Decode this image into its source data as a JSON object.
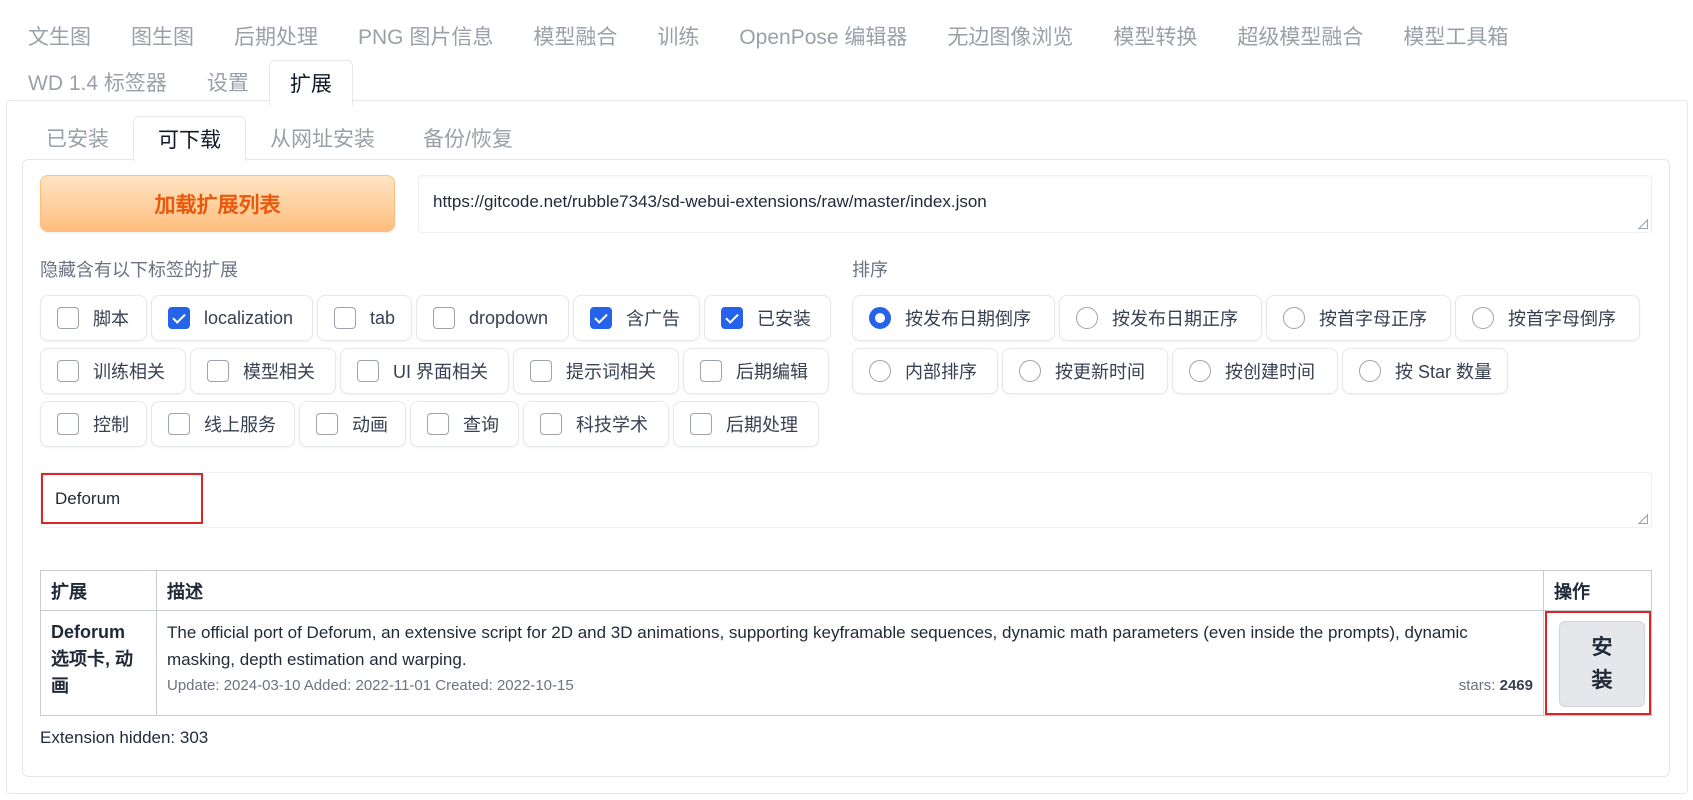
{
  "top_tabs": {
    "row1": [
      "文生图",
      "图生图",
      "后期处理",
      "PNG 图片信息",
      "模型融合",
      "训练",
      "OpenPose 编辑器",
      "无边图像浏览",
      "模型转换",
      "超级模型融合",
      "模型工具箱"
    ],
    "row2": [
      "WD 1.4 标签器",
      "设置",
      "扩展"
    ],
    "active": "扩展"
  },
  "sub_tabs": {
    "items": [
      "已安装",
      "可下载",
      "从网址安装",
      "备份/恢复"
    ],
    "active": "可下载"
  },
  "load_button_label": "加载扩展列表",
  "url_value": "https://gitcode.net/rubble7343/sd-webui-extensions/raw/master/index.json",
  "hide_tags": {
    "label": "隐藏含有以下标签的扩展",
    "rows": [
      [
        {
          "label": "脚本",
          "checked": false
        },
        {
          "label": "localization",
          "checked": true
        },
        {
          "label": "tab",
          "checked": false
        },
        {
          "label": "dropdown",
          "checked": false
        },
        {
          "label": "含广告",
          "checked": true
        },
        {
          "label": "已安装",
          "checked": true
        }
      ],
      [
        {
          "label": "训练相关",
          "checked": false
        },
        {
          "label": "模型相关",
          "checked": false
        },
        {
          "label": "UI 界面相关",
          "checked": false
        },
        {
          "label": "提示词相关",
          "checked": false
        },
        {
          "label": "后期编辑",
          "checked": false
        }
      ],
      [
        {
          "label": "控制",
          "checked": false
        },
        {
          "label": "线上服务",
          "checked": false
        },
        {
          "label": "动画",
          "checked": false
        },
        {
          "label": "查询",
          "checked": false
        },
        {
          "label": "科技学术",
          "checked": false
        },
        {
          "label": "后期处理",
          "checked": false
        }
      ]
    ]
  },
  "sort": {
    "label": "排序",
    "rows": [
      [
        {
          "label": "按发布日期倒序",
          "selected": true
        },
        {
          "label": "按发布日期正序",
          "selected": false
        },
        {
          "label": "按首字母正序",
          "selected": false
        },
        {
          "label": "按首字母倒序",
          "selected": false
        }
      ],
      [
        {
          "label": "内部排序",
          "selected": false
        },
        {
          "label": "按更新时间",
          "selected": false
        },
        {
          "label": "按创建时间",
          "selected": false
        },
        {
          "label": "按 Star 数量",
          "selected": false
        }
      ]
    ]
  },
  "search_value": "Deforum",
  "table": {
    "headers": [
      "扩展",
      "描述",
      "操作"
    ],
    "rows": [
      {
        "name_lines": [
          "Deforum",
          "选项卡, 动",
          "画"
        ],
        "description": "The official port of Deforum, an extensive script for 2D and 3D animations, supporting keyframable sequences, dynamic math parameters (even inside the prompts), dynamic masking, depth estimation and warping.",
        "meta": "Update: 2024-03-10 Added: 2022-11-01 Created: 2022-10-15",
        "stars_label": "stars:",
        "stars": "2469",
        "action_label": "安装"
      }
    ]
  },
  "hidden_count_text": "Extension hidden: 303"
}
